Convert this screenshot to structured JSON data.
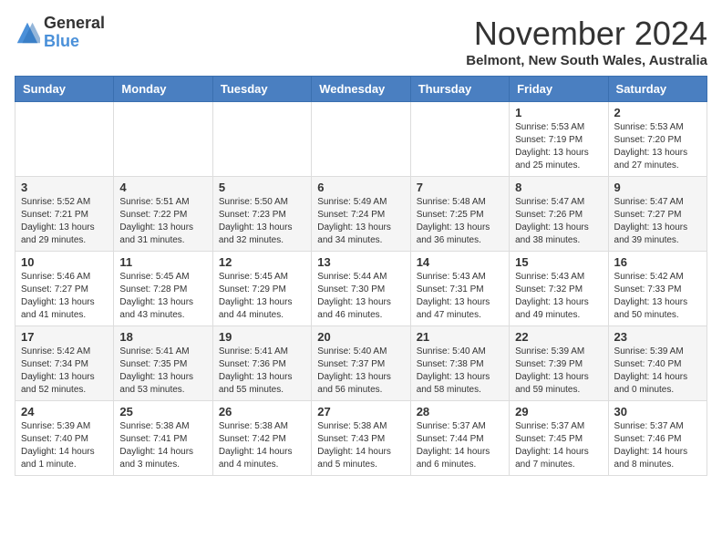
{
  "header": {
    "logo_general": "General",
    "logo_blue": "Blue",
    "month_title": "November 2024",
    "location": "Belmont, New South Wales, Australia"
  },
  "weekdays": [
    "Sunday",
    "Monday",
    "Tuesday",
    "Wednesday",
    "Thursday",
    "Friday",
    "Saturday"
  ],
  "weeks": [
    [
      {
        "day": "",
        "detail": ""
      },
      {
        "day": "",
        "detail": ""
      },
      {
        "day": "",
        "detail": ""
      },
      {
        "day": "",
        "detail": ""
      },
      {
        "day": "",
        "detail": ""
      },
      {
        "day": "1",
        "detail": "Sunrise: 5:53 AM\nSunset: 7:19 PM\nDaylight: 13 hours\nand 25 minutes."
      },
      {
        "day": "2",
        "detail": "Sunrise: 5:53 AM\nSunset: 7:20 PM\nDaylight: 13 hours\nand 27 minutes."
      }
    ],
    [
      {
        "day": "3",
        "detail": "Sunrise: 5:52 AM\nSunset: 7:21 PM\nDaylight: 13 hours\nand 29 minutes."
      },
      {
        "day": "4",
        "detail": "Sunrise: 5:51 AM\nSunset: 7:22 PM\nDaylight: 13 hours\nand 31 minutes."
      },
      {
        "day": "5",
        "detail": "Sunrise: 5:50 AM\nSunset: 7:23 PM\nDaylight: 13 hours\nand 32 minutes."
      },
      {
        "day": "6",
        "detail": "Sunrise: 5:49 AM\nSunset: 7:24 PM\nDaylight: 13 hours\nand 34 minutes."
      },
      {
        "day": "7",
        "detail": "Sunrise: 5:48 AM\nSunset: 7:25 PM\nDaylight: 13 hours\nand 36 minutes."
      },
      {
        "day": "8",
        "detail": "Sunrise: 5:47 AM\nSunset: 7:26 PM\nDaylight: 13 hours\nand 38 minutes."
      },
      {
        "day": "9",
        "detail": "Sunrise: 5:47 AM\nSunset: 7:27 PM\nDaylight: 13 hours\nand 39 minutes."
      }
    ],
    [
      {
        "day": "10",
        "detail": "Sunrise: 5:46 AM\nSunset: 7:27 PM\nDaylight: 13 hours\nand 41 minutes."
      },
      {
        "day": "11",
        "detail": "Sunrise: 5:45 AM\nSunset: 7:28 PM\nDaylight: 13 hours\nand 43 minutes."
      },
      {
        "day": "12",
        "detail": "Sunrise: 5:45 AM\nSunset: 7:29 PM\nDaylight: 13 hours\nand 44 minutes."
      },
      {
        "day": "13",
        "detail": "Sunrise: 5:44 AM\nSunset: 7:30 PM\nDaylight: 13 hours\nand 46 minutes."
      },
      {
        "day": "14",
        "detail": "Sunrise: 5:43 AM\nSunset: 7:31 PM\nDaylight: 13 hours\nand 47 minutes."
      },
      {
        "day": "15",
        "detail": "Sunrise: 5:43 AM\nSunset: 7:32 PM\nDaylight: 13 hours\nand 49 minutes."
      },
      {
        "day": "16",
        "detail": "Sunrise: 5:42 AM\nSunset: 7:33 PM\nDaylight: 13 hours\nand 50 minutes."
      }
    ],
    [
      {
        "day": "17",
        "detail": "Sunrise: 5:42 AM\nSunset: 7:34 PM\nDaylight: 13 hours\nand 52 minutes."
      },
      {
        "day": "18",
        "detail": "Sunrise: 5:41 AM\nSunset: 7:35 PM\nDaylight: 13 hours\nand 53 minutes."
      },
      {
        "day": "19",
        "detail": "Sunrise: 5:41 AM\nSunset: 7:36 PM\nDaylight: 13 hours\nand 55 minutes."
      },
      {
        "day": "20",
        "detail": "Sunrise: 5:40 AM\nSunset: 7:37 PM\nDaylight: 13 hours\nand 56 minutes."
      },
      {
        "day": "21",
        "detail": "Sunrise: 5:40 AM\nSunset: 7:38 PM\nDaylight: 13 hours\nand 58 minutes."
      },
      {
        "day": "22",
        "detail": "Sunrise: 5:39 AM\nSunset: 7:39 PM\nDaylight: 13 hours\nand 59 minutes."
      },
      {
        "day": "23",
        "detail": "Sunrise: 5:39 AM\nSunset: 7:40 PM\nDaylight: 14 hours\nand 0 minutes."
      }
    ],
    [
      {
        "day": "24",
        "detail": "Sunrise: 5:39 AM\nSunset: 7:40 PM\nDaylight: 14 hours\nand 1 minute."
      },
      {
        "day": "25",
        "detail": "Sunrise: 5:38 AM\nSunset: 7:41 PM\nDaylight: 14 hours\nand 3 minutes."
      },
      {
        "day": "26",
        "detail": "Sunrise: 5:38 AM\nSunset: 7:42 PM\nDaylight: 14 hours\nand 4 minutes."
      },
      {
        "day": "27",
        "detail": "Sunrise: 5:38 AM\nSunset: 7:43 PM\nDaylight: 14 hours\nand 5 minutes."
      },
      {
        "day": "28",
        "detail": "Sunrise: 5:37 AM\nSunset: 7:44 PM\nDaylight: 14 hours\nand 6 minutes."
      },
      {
        "day": "29",
        "detail": "Sunrise: 5:37 AM\nSunset: 7:45 PM\nDaylight: 14 hours\nand 7 minutes."
      },
      {
        "day": "30",
        "detail": "Sunrise: 5:37 AM\nSunset: 7:46 PM\nDaylight: 14 hours\nand 8 minutes."
      }
    ]
  ]
}
